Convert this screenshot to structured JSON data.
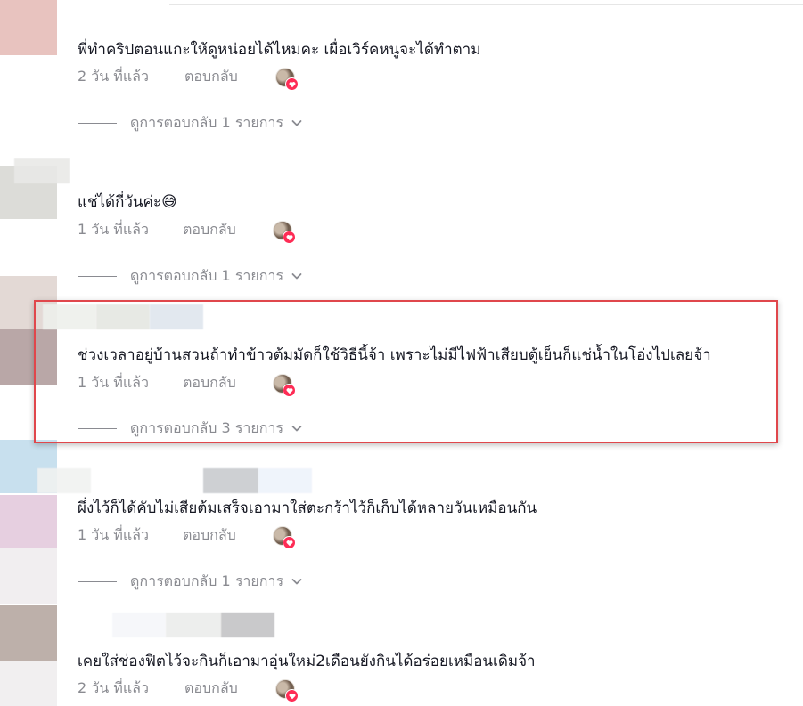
{
  "comments": [
    {
      "text": "พี่ทำคริปตอนแกะให้ดูหน่อยได้ไหมคะ เผื่อเวิร์คหนูจะได้ทำตาม",
      "time": "2 วัน ที่แล้ว",
      "reply_label": "ตอบกลับ",
      "view_replies": "ดูการตอบกลับ 1 รายการ"
    },
    {
      "text": "แช่ได้กี่วันค่ะ",
      "emoji": "😅",
      "time": "1 วัน ที่แล้ว",
      "reply_label": "ตอบกลับ",
      "view_replies": "ดูการตอบกลับ 1 รายการ"
    },
    {
      "text": "ช่วงเวลาอยู่บ้านสวนถ้าทำข้าวต้มมัดก็ใช้วิธีนี้จ้า เพราะไม่มีไฟฟ้าเสียบตู้เย็นก็แช่น้ำในโอ่งไปเลยจ้า",
      "time": "1 วัน ที่แล้ว",
      "reply_label": "ตอบกลับ",
      "view_replies": "ดูการตอบกลับ 3 รายการ",
      "highlighted": true
    },
    {
      "text": "ผึ่งไว้ก็ได้คับไม่เสียต้มเสร็จเอามาใส่ตะกร้าไว้ก็เก็บได้หลายวันเหมือนกัน",
      "time": "1 วัน ที่แล้ว",
      "reply_label": "ตอบกลับ",
      "view_replies": "ดูการตอบกลับ 1 รายการ"
    },
    {
      "text": "เคยใส่ช่องฟิตไว้จะกินก็เอามาอุ่นใหม่2เดือนยังกินได้อร่อยเหมือนเดิมจ้า",
      "time": "2 วัน ที่แล้ว",
      "reply_label": "ตอบกลับ"
    }
  ],
  "colors": {
    "highlight_border": "#e0474c",
    "heart": "#fe2c55",
    "muted_text": "#8a8b91",
    "body_text": "#161823"
  }
}
